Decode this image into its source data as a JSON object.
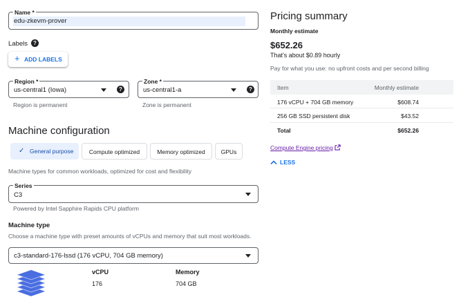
{
  "form": {
    "name_label": "Name *",
    "name_value": "edu-zkevm-prover",
    "labels_title": "Labels",
    "add_labels": "ADD LABELS",
    "region_label": "Region *",
    "region_value": "us-central1 (Iowa)",
    "region_hint": "Region is permanent",
    "zone_label": "Zone *",
    "zone_value": "us-central1-a",
    "zone_hint": "Zone is permanent"
  },
  "machine_config": {
    "title": "Machine configuration",
    "tabs": [
      {
        "label": "General purpose",
        "active": true
      },
      {
        "label": "Compute optimized",
        "active": false
      },
      {
        "label": "Memory optimized",
        "active": false
      },
      {
        "label": "GPUs",
        "active": false
      }
    ],
    "tab_description": "Machine types for common workloads, optimized for cost and flexibility",
    "series_label": "Series",
    "series_value": "C3",
    "series_hint": "Powered by Intel Sapphire Rapids CPU platform",
    "machine_type_title": "Machine type",
    "machine_type_description": "Choose a machine type with preset amounts of vCPUs and memory that suit most workloads.",
    "machine_type_value": "c3-standard-176-lssd (176 vCPU, 704 GB memory)",
    "vcpu_header": "vCPU",
    "vcpu_value": "176",
    "memory_header": "Memory",
    "memory_value": "704 GB"
  },
  "pricing": {
    "title": "Pricing summary",
    "subtitle": "Monthly estimate",
    "total": "$652.26",
    "hourly": "That's about $0.89 hourly",
    "note": "Pay for what you use: no upfront costs and per second billing",
    "table_headers": [
      "Item",
      "Monthly estimate"
    ],
    "rows": [
      {
        "item": "176 vCPU + 704 GB memory",
        "cost": "$608.74"
      },
      {
        "item": "256 GB SSD persistent disk",
        "cost": "$43.52"
      },
      {
        "item": "Total",
        "cost": "$652.26"
      }
    ],
    "link": "Compute Engine pricing",
    "less": "LESS"
  },
  "icons": {
    "help": "help-icon",
    "add": "plus-icon",
    "check": "check-icon",
    "dropdown": "caret-down-icon",
    "external": "external-link-icon",
    "chevron": "chevron-up-icon",
    "chip": "stacked-layers-icon"
  },
  "colors": {
    "accent": "#1a73e8",
    "chip_active_bg": "#e8f0fe",
    "link": "#1a73e8",
    "link_visited": "#681da8",
    "stack_icon": "#4a6ee0"
  }
}
